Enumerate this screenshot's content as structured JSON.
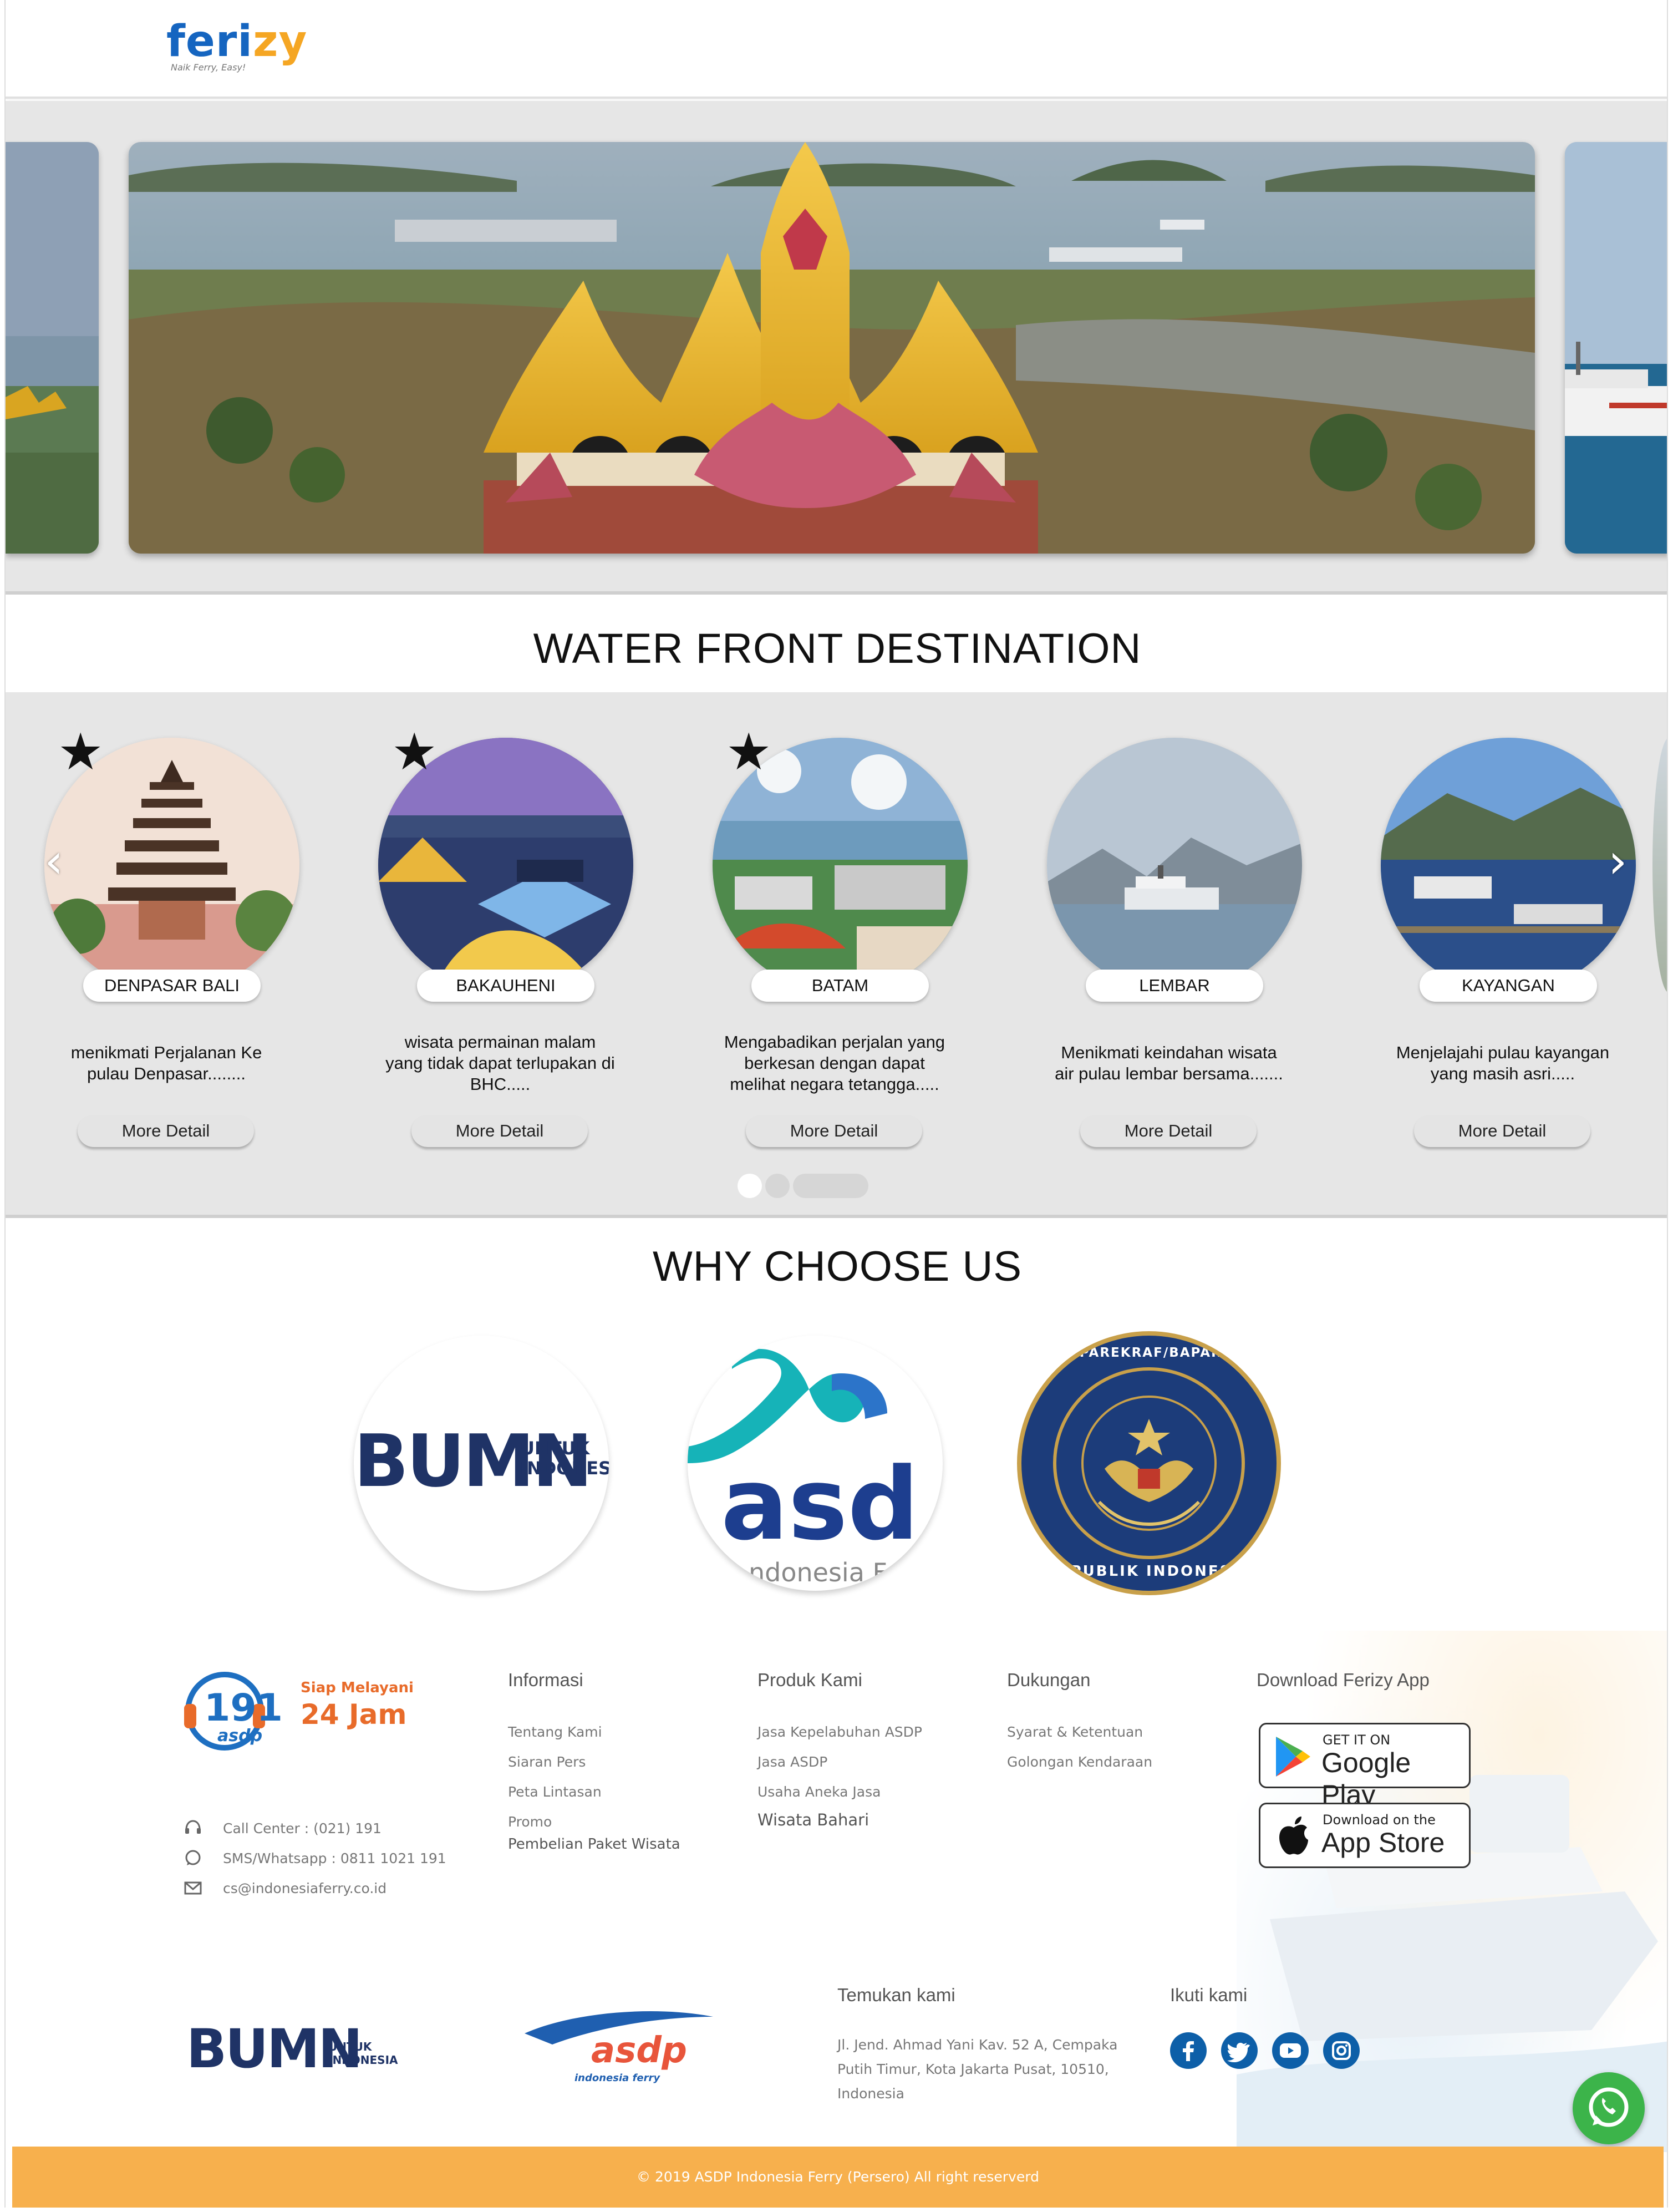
{
  "brand": {
    "logo_text_left": "feri",
    "logo_text_right": "zy",
    "tagline": "Naik Ferry, Easy!"
  },
  "hero": {
    "slides_visible": 3
  },
  "water_front": {
    "title": "WATER FRONT DESTINATION",
    "destinations": [
      {
        "name": "DENPASAR BALI",
        "description": "menikmati Perjalanan Ke pulau Denpasar........",
        "button": "More Detail",
        "featured": true
      },
      {
        "name": "BAKAUHENI",
        "description": "wisata permainan malam yang tidak dapat terlupakan di BHC.....",
        "button": "More Detail",
        "featured": true
      },
      {
        "name": "BATAM",
        "description": "Mengabadikan perjalan yang berkesan dengan dapat melihat negara tetangga.....",
        "button": "More Detail",
        "featured": true
      },
      {
        "name": "LEMBAR",
        "description": "Menikmati keindahan wisata air pulau lembar bersama.......",
        "button": "More Detail",
        "featured": false
      },
      {
        "name": "KAYANGAN",
        "description": "Menjelajahi pulau kayangan yang masih asri.....",
        "button": "More Detail",
        "featured": false
      }
    ],
    "pagination": {
      "active_index": 0,
      "count": 3
    }
  },
  "why_choose_us": {
    "title": "WHY CHOOSE US",
    "partners": [
      {
        "mark": "BUMN",
        "sub": "UNTUK INDONES"
      },
      {
        "mark": "asd",
        "sub": "ndonesia Fe"
      },
      {
        "top_text": "KEMENPAREKRAF/BAPAREKRAF",
        "bottom_text": "REPUBLIK INDONESIA"
      }
    ]
  },
  "footer": {
    "service_badge": {
      "number": "191",
      "brand": "asdp",
      "line1": "Siap Melayani",
      "line2": "24 Jam"
    },
    "contacts": [
      {
        "icon": "headset-icon",
        "text": "Call Center : (021) 191"
      },
      {
        "icon": "whatsapp-icon",
        "text": "SMS/Whatsapp : 0811 1021 191"
      },
      {
        "icon": "mail-icon",
        "text": "cs@indonesiaferry.co.id"
      }
    ],
    "columns": [
      {
        "title": "Informasi",
        "links": [
          "Tentang Kami",
          "Siaran Pers",
          "Peta Lintasan",
          "Promo",
          "Pembelian Paket Wisata"
        ]
      },
      {
        "title": "Produk Kami",
        "links": [
          "Jasa Kepelabuhan ASDP",
          "Jasa ASDP",
          "Usaha Aneka Jasa",
          "Wisata Bahari"
        ]
      },
      {
        "title": "Dukungan",
        "links": [
          "Syarat & Ketentuan",
          "Golongan Kendaraan"
        ]
      }
    ],
    "download": {
      "title": "Download Ferizy App",
      "google_small": "GET IT ON",
      "google_big": "Google Play",
      "apple_small": "Download on the",
      "apple_big": "App Store"
    },
    "bumn_logo": {
      "mark": "BUMN",
      "sub1": "UNTUK",
      "sub2": "INDONESIA"
    },
    "asdp_logo": {
      "mark": "asdp",
      "sub": "indonesia ferry"
    },
    "find_us": {
      "title": "Temukan kami",
      "address": [
        "Jl. Jend. Ahmad Yani Kav. 52 A, Cempaka",
        "Putih Timur, Kota Jakarta Pusat, 10510,",
        "Indonesia"
      ]
    },
    "follow": {
      "title": "Ikuti kami",
      "icons": [
        "facebook-icon",
        "twitter-icon",
        "youtube-icon",
        "instagram-icon"
      ]
    },
    "copyright": "© 2019 ASDP Indonesia Ferry (Persero) All right reserverd"
  },
  "colors": {
    "brand_blue": "#1565c0",
    "brand_orange": "#f5a623",
    "footer_bar": "#f7b04d",
    "whatsapp": "#3cb44a",
    "social": "#0d5fa8"
  }
}
